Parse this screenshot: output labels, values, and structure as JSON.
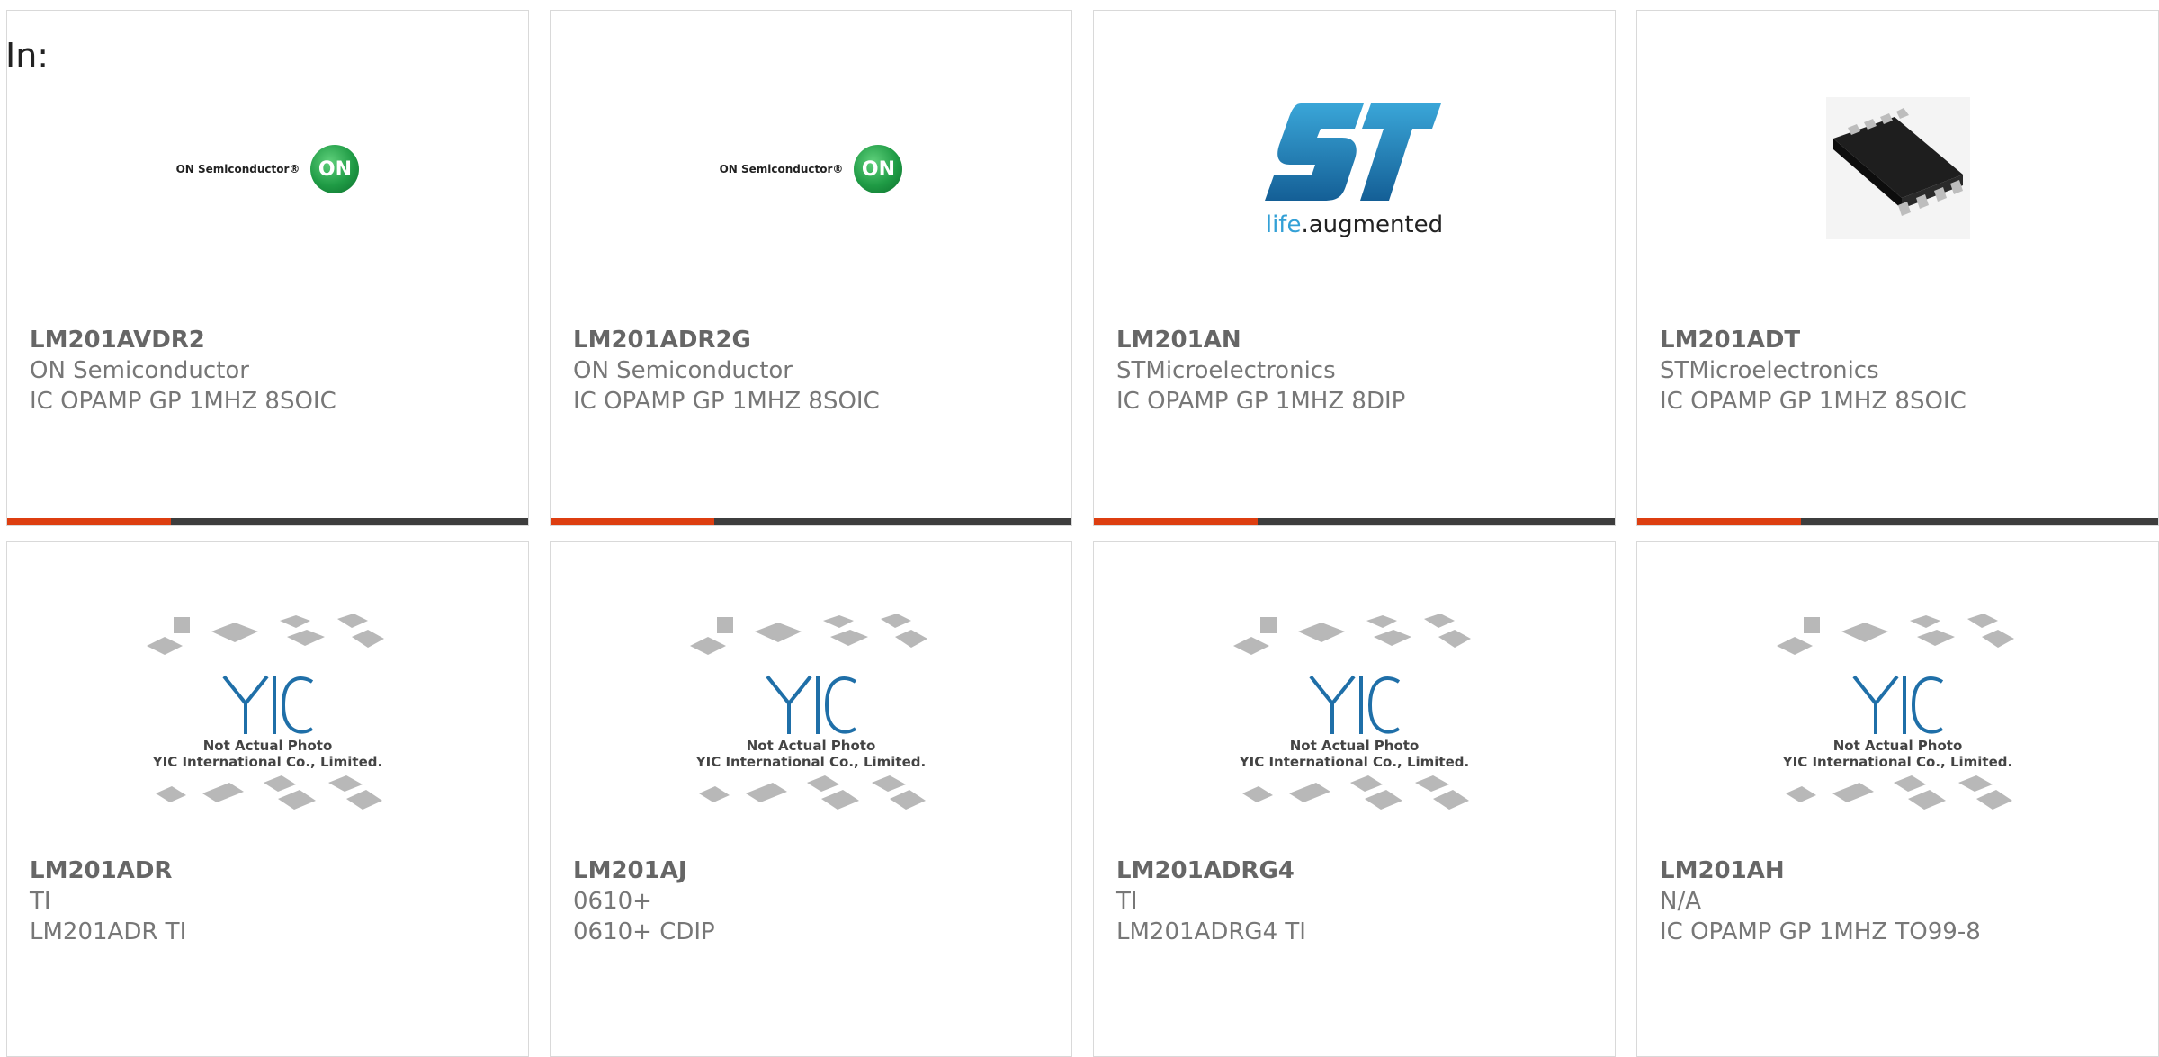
{
  "header": {
    "in_label": "In:"
  },
  "colors": {
    "accent": "#dd3e10",
    "bar": "#3d3d3d",
    "on_green": "#1f9b45",
    "st_blue": "#1f6fa8"
  },
  "logos": {
    "on_semi": {
      "wordmark": "ON Semiconductor®",
      "mark": "ON"
    },
    "st": {
      "tagline_a": "life",
      "tagline_b": ".augmented"
    },
    "placeholder": {
      "caption_1": "Not Actual Photo",
      "caption_2": "YIC International Co., Limited."
    }
  },
  "products": [
    {
      "part": "LM201AVDR2",
      "manufacturer": "ON Semiconductor",
      "description": "IC OPAMP GP 1MHZ 8SOIC",
      "image": "on-semiconductor-logo"
    },
    {
      "part": "LM201ADR2G",
      "manufacturer": "ON Semiconductor",
      "description": "IC OPAMP GP 1MHZ 8SOIC",
      "image": "on-semiconductor-logo"
    },
    {
      "part": "LM201AN",
      "manufacturer": "STMicroelectronics",
      "description": "IC OPAMP GP 1MHZ 8DIP",
      "image": "st-logo"
    },
    {
      "part": "LM201ADT",
      "manufacturer": "STMicroelectronics",
      "description": "IC OPAMP GP 1MHZ 8SOIC",
      "image": "soic-chip-photo"
    },
    {
      "part": "LM201ADR",
      "manufacturer": "TI",
      "description": "LM201ADR TI",
      "image": "not-actual-photo"
    },
    {
      "part": "LM201AJ",
      "manufacturer": "0610+",
      "description": "0610+ CDIP",
      "image": "not-actual-photo"
    },
    {
      "part": "LM201ADRG4",
      "manufacturer": "TI",
      "description": "LM201ADRG4 TI",
      "image": "not-actual-photo"
    },
    {
      "part": "LM201AH",
      "manufacturer": "N/A",
      "description": "IC OPAMP GP 1MHZ TO99-8",
      "image": "not-actual-photo"
    }
  ]
}
